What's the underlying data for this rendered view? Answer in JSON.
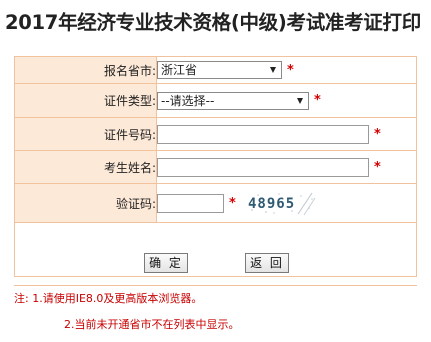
{
  "page": {
    "title": "2017年经济专业技术资格(中级)考试准考证打印"
  },
  "form": {
    "province_label": "报名省市:",
    "province_value": "浙江省",
    "id_type_label": "证件类型:",
    "id_type_value": "--请选择--",
    "id_number_label": "证件号码:",
    "name_label": "考生姓名:",
    "captcha_label": "验证码:",
    "captcha_text": "48965",
    "required_mark": "*"
  },
  "buttons": {
    "confirm": "确 定",
    "back": "返 回"
  },
  "notes": {
    "line1": "注: 1.请使用IE8.0及更高版本浏览器。",
    "line2": "2.当前未开通省市不在列表中显示。"
  },
  "colors": {
    "label_bg": "#fce9d8",
    "border": "#f0c29d",
    "required": "#d40000",
    "note_text": "#c80000"
  }
}
